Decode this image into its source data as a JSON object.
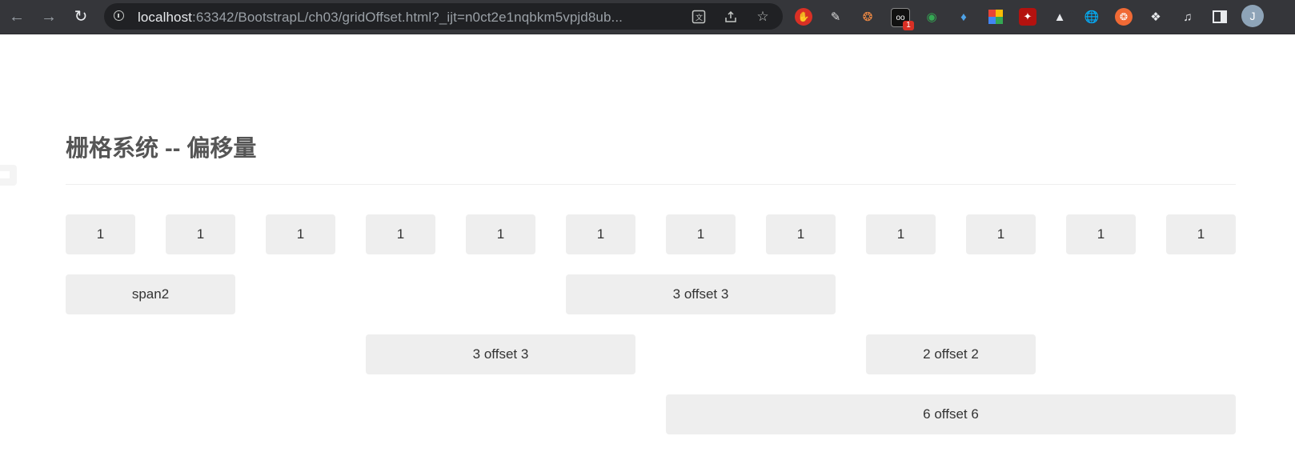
{
  "browser": {
    "url_host": "localhost",
    "url_rest": ":63342/BootstrapL/ch03/gridOffset.html?_ijt=n0ct2e1nqbkm5vpjd8ub...",
    "extension_badge": "1",
    "profile_initial": "J"
  },
  "page": {
    "title": "栅格系统 -- 偏移量"
  },
  "grid": {
    "row1": [
      "1",
      "1",
      "1",
      "1",
      "1",
      "1",
      "1",
      "1",
      "1",
      "1",
      "1",
      "1"
    ],
    "row2": [
      "span2",
      "3 offset 3"
    ],
    "row3": [
      "3 offset 3",
      "2 offset 2"
    ],
    "row4": [
      "6 offset 6"
    ]
  },
  "colors": {
    "cell_background": "#eeeeee",
    "title_text": "#555555",
    "chrome_toolbar": "#35363a"
  }
}
